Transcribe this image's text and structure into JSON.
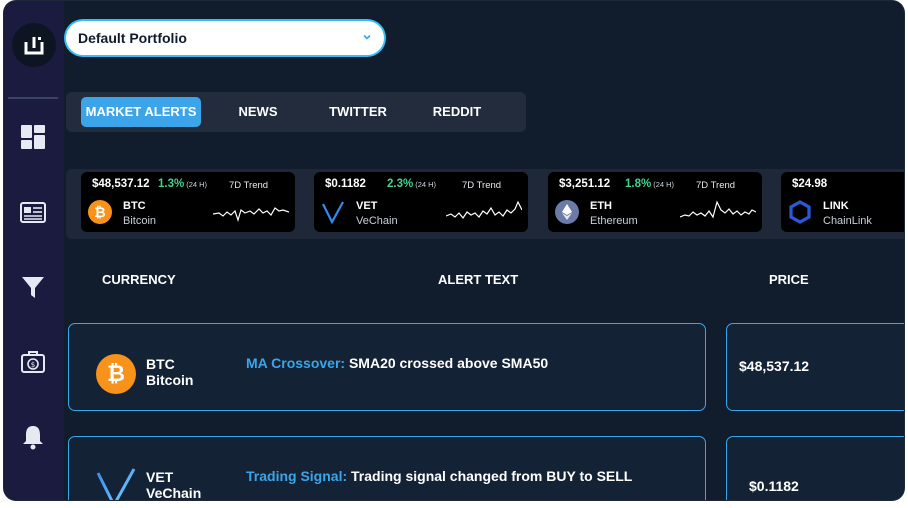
{
  "portfolio": {
    "selected": "Default Portfolio"
  },
  "tabs": [
    {
      "label": "MARKET ALERTS",
      "active": true
    },
    {
      "label": "NEWS",
      "active": false
    },
    {
      "label": "TWITTER",
      "active": false
    },
    {
      "label": "REDDIT",
      "active": false
    }
  ],
  "tickers": [
    {
      "price": "$48,537.12",
      "change": "1.3%",
      "period": "(24 H)",
      "trend_label": "7D Trend",
      "symbol": "BTC",
      "name": "Bitcoin",
      "icon": "bitcoin-icon"
    },
    {
      "price": "$0.1182",
      "change": "2.3%",
      "period": "(24 H)",
      "trend_label": "7D Trend",
      "symbol": "VET",
      "name": "VeChain",
      "icon": "vechain-icon"
    },
    {
      "price": "$3,251.12",
      "change": "1.8%",
      "period": "(24 H)",
      "trend_label": "7D Trend",
      "symbol": "ETH",
      "name": "Ethereum",
      "icon": "ethereum-icon"
    },
    {
      "price": "$24.98",
      "symbol": "LINK",
      "name": "ChainLink",
      "icon": "chainlink-icon"
    }
  ],
  "columns": {
    "currency": "CURRENCY",
    "alert_text": "ALERT TEXT",
    "price": "PRICE"
  },
  "alerts": [
    {
      "symbol": "BTC",
      "name": "Bitcoin",
      "type": "MA Crossover:",
      "text": "SMA20 crossed above SMA50",
      "price": "$48,537.12",
      "icon": "bitcoin-icon"
    },
    {
      "symbol": "VET",
      "name": "VeChain",
      "type": "Trading Signal:",
      "text": "Trading signal changed from BUY to SELL",
      "price": "$0.1182",
      "icon": "vechain-icon"
    }
  ],
  "sidebar": {
    "items": [
      {
        "icon": "dashboard-icon"
      },
      {
        "icon": "news-icon"
      },
      {
        "icon": "filter-icon"
      },
      {
        "icon": "portfolio-icon"
      },
      {
        "icon": "bell-icon"
      }
    ]
  },
  "colors": {
    "accent": "#3ca5e9",
    "positive": "#3dd68c",
    "background": "#111d2c",
    "sidebar": "#1b1b3f",
    "bitcoin": "#f7931a",
    "chainlink": "#2a5ada"
  }
}
